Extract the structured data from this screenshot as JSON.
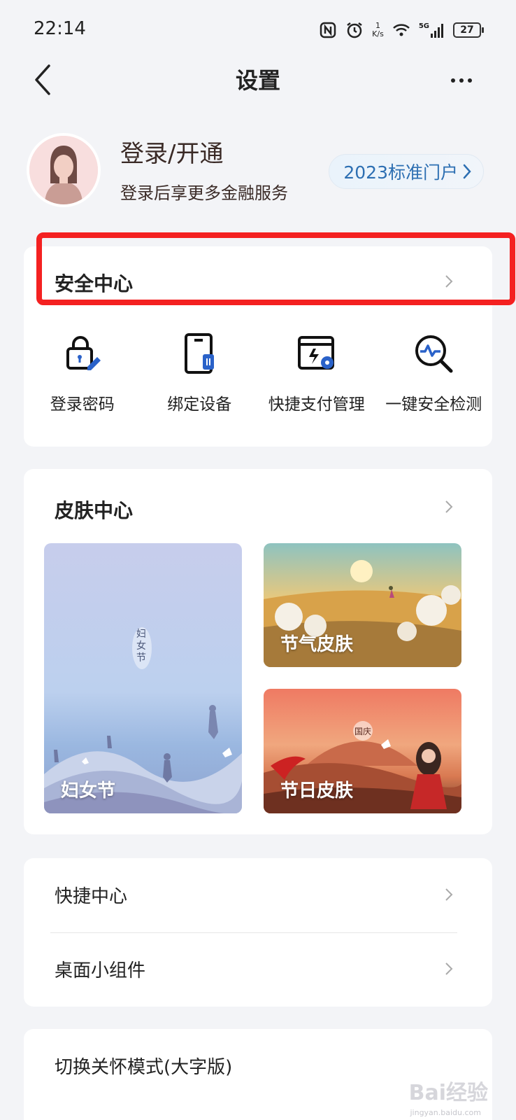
{
  "status_bar": {
    "time": "22:14",
    "netspeed_value": "1",
    "netspeed_unit": "K/s",
    "network": "5G",
    "battery": "27"
  },
  "nav": {
    "title": "设置"
  },
  "profile": {
    "title": "登录/开通",
    "subtitle": "登录后享更多金融服务",
    "portal_label": "2023标准门户"
  },
  "security": {
    "title": "安全中心",
    "items": [
      {
        "label": "登录密码",
        "icon": "lock-edit-icon"
      },
      {
        "label": "绑定设备",
        "icon": "device-link-icon"
      },
      {
        "label": "快捷支付管理",
        "icon": "card-lightning-icon"
      },
      {
        "label": "一键安全检测",
        "icon": "scan-check-icon"
      }
    ]
  },
  "skins": {
    "title": "皮肤中心",
    "items": [
      {
        "label": "妇女节",
        "badge": "妇女节"
      },
      {
        "label": "节气皮肤"
      },
      {
        "label": "节日皮肤",
        "badge": "国庆"
      }
    ]
  },
  "list1": [
    {
      "label": "快捷中心"
    },
    {
      "label": "桌面小组件"
    }
  ],
  "list2": [
    {
      "label": "切换关怀模式(大字版)"
    }
  ],
  "watermark": {
    "text": "Bai经验",
    "sub": "jingyan.baidu.com"
  },
  "colors": {
    "accent": "#2d6fb2",
    "highlight": "#f42121",
    "background": "#f3f4f7"
  }
}
